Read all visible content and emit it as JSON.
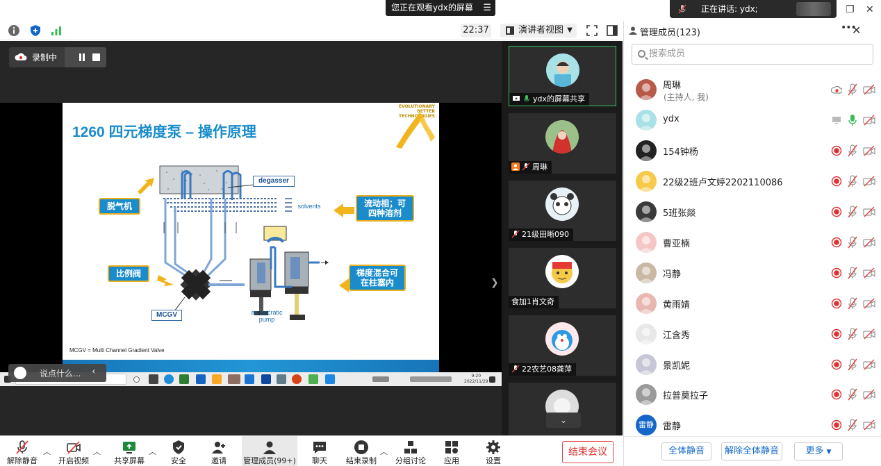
{
  "titlebar": {
    "watching_text": "您正在观看ydx的屏幕",
    "speaking_text": "正在讲话: ydx;"
  },
  "toolbar": {
    "time": "22:37",
    "view_mode": "演讲者视图"
  },
  "recording": {
    "label": "录制中"
  },
  "slide": {
    "title": "1260 四元梯度泵 – 操作原理",
    "logo_text": "EVOLUTIONARY BETTER TECHNOLOGIES",
    "callout_degasser_cn": "脱气机",
    "callout_mobile": "流动相；可四种溶剂",
    "callout_valve": "比例阀",
    "callout_mixing": "梯度混合可在柱塞内",
    "label_degasser": "degasser",
    "label_solvents": "solvents",
    "label_mcgv": "MCGV",
    "label_pump": "as isocratic pump",
    "footnote": "MCGV = Multi Channel Gradient Valve"
  },
  "taskbar": {
    "time": "9:20",
    "date": "2022/11/29"
  },
  "chat": {
    "placeholder": "说点什么..."
  },
  "videos": [
    {
      "name": "ydx的屏幕共享",
      "active": true
    },
    {
      "name": "周琳"
    },
    {
      "name": "21级田晰090"
    },
    {
      "name": "食加1肖文奇"
    },
    {
      "name": "22农艺08龚萍"
    }
  ],
  "panel": {
    "title": "管理成员(123)",
    "search_placeholder": "搜索成员",
    "members": [
      {
        "name": "周琳",
        "sub": "(主持人, 我)"
      },
      {
        "name": "ydx"
      },
      {
        "name": "154钟杨"
      },
      {
        "name": "22级2班卢文婷2202110086"
      },
      {
        "name": "5班张燚"
      },
      {
        "name": "曹亚楠"
      },
      {
        "name": "冯静"
      },
      {
        "name": "黄雨婧"
      },
      {
        "name": "江含秀"
      },
      {
        "name": "景凯妮"
      },
      {
        "name": "拉普莫拉子"
      },
      {
        "name": "雷静",
        "avatar_text": "雷静"
      }
    ],
    "mute_all": "全体静音",
    "unmute_all": "解除全体静音",
    "more": "更多"
  },
  "controls": {
    "unmute": "解除静音",
    "video": "开启视频",
    "share": "共享屏幕",
    "security": "安全",
    "invite": "邀请",
    "participants": "管理成员(99+)",
    "chat": "聊天",
    "stop_record": "结束录制",
    "breakout": "分组讨论",
    "apps": "应用",
    "settings": "设置",
    "end": "结束会议"
  },
  "colors": {
    "accent_blue": "#1467c8",
    "slide_blue": "#1a8ccc",
    "callout_border": "#e8b020",
    "record_red": "#e03030",
    "active_green": "#3bbd5a"
  }
}
